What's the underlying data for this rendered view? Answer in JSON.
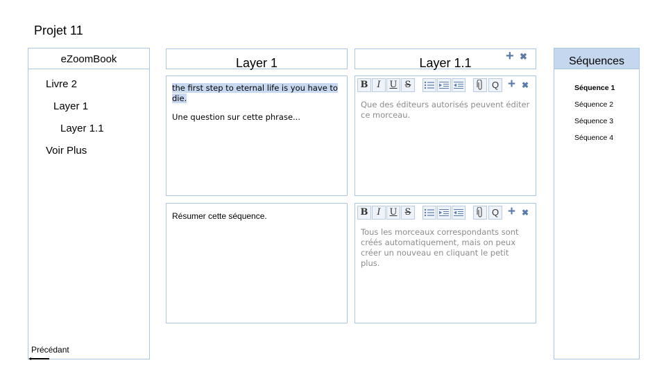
{
  "project": {
    "title": "Projet 11"
  },
  "left_panel": {
    "header": "eZoomBook",
    "items": [
      {
        "label": "Livre 2"
      },
      {
        "label": "Layer 1"
      },
      {
        "label": "Layer 1.1"
      },
      {
        "label": "Voir Plus"
      }
    ],
    "prev_label": "Précédant"
  },
  "layer1": {
    "header": "Layer 1",
    "top_highlight": "the first step to eternal life is you have to die.",
    "top_question": "Une question sur cette phrase...",
    "bottom_text": "Résumer cette séquence."
  },
  "layer11": {
    "header": "Layer 1.1",
    "top_text": "Que des éditeurs autorisés peuvent éditer ce morceau.",
    "bottom_text": "Tous les morceaux correspondants sont créés automatiquement, mais on peux créer un nouveau en cliquant le petit plus."
  },
  "toolbar": {
    "bold": "B",
    "italic": "I",
    "underline": "U",
    "strike": "S",
    "attach_icon": "paperclip-icon",
    "comment": "Q",
    "plus": "+",
    "close": "✖"
  },
  "sequences": {
    "header": "Séquences",
    "items": [
      {
        "label": "Séquence 1",
        "active": true
      },
      {
        "label": "Séquence 2",
        "active": false
      },
      {
        "label": "Séquence 3",
        "active": false
      },
      {
        "label": "Séquence 4",
        "active": false
      }
    ]
  },
  "colors": {
    "border": "#a9c6e3",
    "header_fill": "#c4d7ee",
    "highlight": "#c8d8f0",
    "icon_blue": "#5a7aa8"
  }
}
